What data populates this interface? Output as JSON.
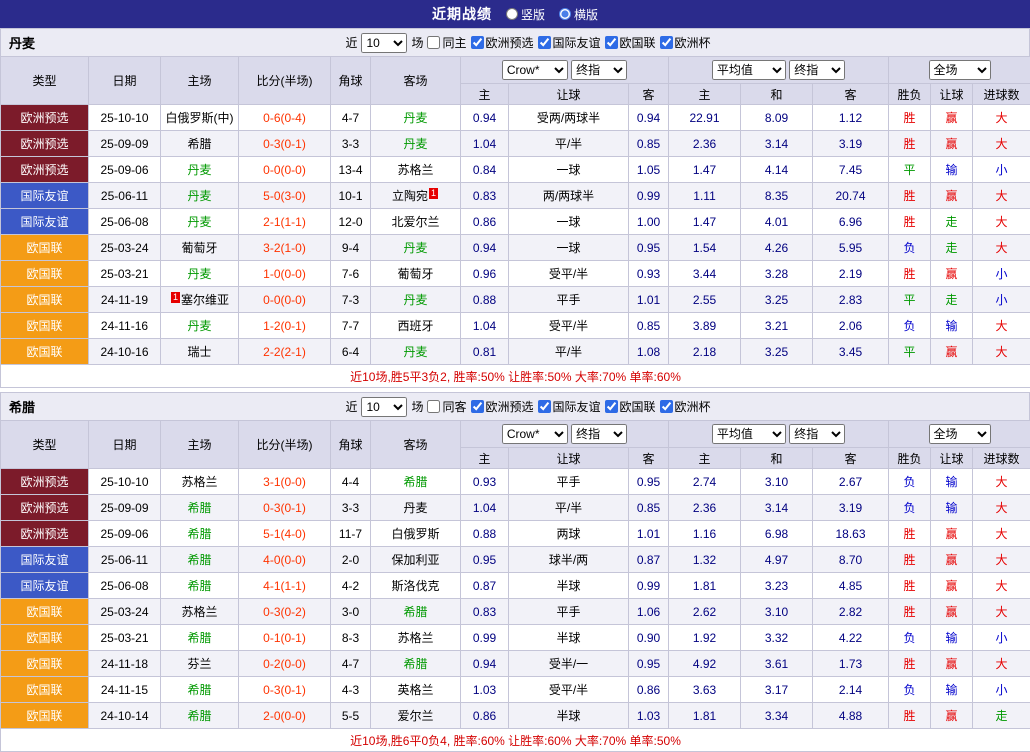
{
  "page": {
    "title": "近期战绩",
    "view_options": [
      {
        "label": "竖版",
        "selected": false
      },
      {
        "label": "横版",
        "selected": true
      }
    ]
  },
  "filter": {
    "near_label": "近",
    "count_value": "10",
    "games_label": "场",
    "competitions": [
      "欧洲预选",
      "国际友谊",
      "欧国联",
      "欧洲杯"
    ]
  },
  "table_header": {
    "cols": [
      "类型",
      "日期",
      "主场",
      "比分(半场)",
      "角球",
      "客场"
    ],
    "bookmaker": "Crow*",
    "final_label": "终指",
    "average_label": "平均值",
    "full_label": "全场",
    "asian_sub": [
      "主",
      "让球",
      "客"
    ],
    "euro_sub": [
      "主",
      "和",
      "客"
    ],
    "result_sub": [
      "胜负",
      "让球",
      "进球数"
    ]
  },
  "colors": {
    "topbar": "#2b2b8c",
    "euro_qualifier": "#7c1b2a",
    "friendly": "#3c59c6",
    "nations_league": "#f49c16",
    "win": "#e60000",
    "draw": "#009900",
    "loss": "#0000cc",
    "score": "#ff3300",
    "team_highlight": "#009900",
    "odds": "#000080",
    "summary": "#d40000"
  },
  "sections": [
    {
      "team": "丹麦",
      "same_label": "同主",
      "summary": "近10场,胜5平3负2, 胜率:50% 让胜率:50% 大率:70% 单率:60%",
      "rows": [
        {
          "type": "欧洲预选",
          "date": "25-10-10",
          "home": "白俄罗斯(中)",
          "away": "丹麦",
          "away_hl": true,
          "score": "0-6(0-4)",
          "corners": "4-7",
          "asian": [
            "0.94",
            "受两/两球半",
            "0.94"
          ],
          "euro": [
            "22.91",
            "8.09",
            "1.12"
          ],
          "results": [
            "胜",
            "赢",
            "大"
          ]
        },
        {
          "type": "欧洲预选",
          "date": "25-09-09",
          "home": "希腊",
          "away": "丹麦",
          "away_hl": true,
          "score": "0-3(0-1)",
          "corners": "3-3",
          "asian": [
            "1.04",
            "平/半",
            "0.85"
          ],
          "euro": [
            "2.36",
            "3.14",
            "3.19"
          ],
          "results": [
            "胜",
            "赢",
            "大"
          ]
        },
        {
          "type": "欧洲预选",
          "date": "25-09-06",
          "home": "丹麦",
          "home_hl": true,
          "away": "苏格兰",
          "score": "0-0(0-0)",
          "corners": "13-4",
          "asian": [
            "0.84",
            "一球",
            "1.05"
          ],
          "euro": [
            "1.47",
            "4.14",
            "7.45"
          ],
          "results": [
            "平",
            "输",
            "小"
          ]
        },
        {
          "type": "国际友谊",
          "date": "25-06-11",
          "home": "丹麦",
          "home_hl": true,
          "away": "立陶宛",
          "away_badge": "1",
          "score": "5-0(3-0)",
          "corners": "10-1",
          "asian": [
            "0.83",
            "两/两球半",
            "0.99"
          ],
          "euro": [
            "1.11",
            "8.35",
            "20.74"
          ],
          "results": [
            "胜",
            "赢",
            "大"
          ]
        },
        {
          "type": "国际友谊",
          "date": "25-06-08",
          "home": "丹麦",
          "home_hl": true,
          "away": "北爱尔兰",
          "score": "2-1(1-1)",
          "corners": "12-0",
          "asian": [
            "0.86",
            "一球",
            "1.00"
          ],
          "euro": [
            "1.47",
            "4.01",
            "6.96"
          ],
          "results": [
            "胜",
            "走",
            "大"
          ]
        },
        {
          "type": "欧国联",
          "date": "25-03-24",
          "home": "葡萄牙",
          "away": "丹麦",
          "away_hl": true,
          "score": "3-2(1-0)",
          "corners": "9-4",
          "asian": [
            "0.94",
            "一球",
            "0.95"
          ],
          "euro": [
            "1.54",
            "4.26",
            "5.95"
          ],
          "results": [
            "负",
            "走",
            "大"
          ]
        },
        {
          "type": "欧国联",
          "date": "25-03-21",
          "home": "丹麦",
          "home_hl": true,
          "away": "葡萄牙",
          "score": "1-0(0-0)",
          "corners": "7-6",
          "asian": [
            "0.96",
            "受平/半",
            "0.93"
          ],
          "euro": [
            "3.44",
            "3.28",
            "2.19"
          ],
          "results": [
            "胜",
            "赢",
            "小"
          ]
        },
        {
          "type": "欧国联",
          "date": "24-11-19",
          "home": "塞尔维亚",
          "home_badge": "1",
          "away": "丹麦",
          "away_hl": true,
          "score": "0-0(0-0)",
          "corners": "7-3",
          "asian": [
            "0.88",
            "平手",
            "1.01"
          ],
          "euro": [
            "2.55",
            "3.25",
            "2.83"
          ],
          "results": [
            "平",
            "走",
            "小"
          ]
        },
        {
          "type": "欧国联",
          "date": "24-11-16",
          "home": "丹麦",
          "home_hl": true,
          "away": "西班牙",
          "score": "1-2(0-1)",
          "corners": "7-7",
          "asian": [
            "1.04",
            "受平/半",
            "0.85"
          ],
          "euro": [
            "3.89",
            "3.21",
            "2.06"
          ],
          "results": [
            "负",
            "输",
            "大"
          ]
        },
        {
          "type": "欧国联",
          "date": "24-10-16",
          "home": "瑞士",
          "away": "丹麦",
          "away_hl": true,
          "score": "2-2(2-1)",
          "corners": "6-4",
          "asian": [
            "0.81",
            "平/半",
            "1.08"
          ],
          "euro": [
            "2.18",
            "3.25",
            "3.45"
          ],
          "results": [
            "平",
            "赢",
            "大"
          ]
        }
      ]
    },
    {
      "team": "希腊",
      "same_label": "同客",
      "summary": "近10场,胜6平0负4, 胜率:60% 让胜率:60% 大率:70% 单率:50%",
      "rows": [
        {
          "type": "欧洲预选",
          "date": "25-10-10",
          "home": "苏格兰",
          "away": "希腊",
          "away_hl": true,
          "score": "3-1(0-0)",
          "corners": "4-4",
          "asian": [
            "0.93",
            "平手",
            "0.95"
          ],
          "euro": [
            "2.74",
            "3.10",
            "2.67"
          ],
          "results": [
            "负",
            "输",
            "大"
          ]
        },
        {
          "type": "欧洲预选",
          "date": "25-09-09",
          "home": "希腊",
          "home_hl": true,
          "away": "丹麦",
          "score": "0-3(0-1)",
          "corners": "3-3",
          "asian": [
            "1.04",
            "平/半",
            "0.85"
          ],
          "euro": [
            "2.36",
            "3.14",
            "3.19"
          ],
          "results": [
            "负",
            "输",
            "大"
          ]
        },
        {
          "type": "欧洲预选",
          "date": "25-09-06",
          "home": "希腊",
          "home_hl": true,
          "away": "白俄罗斯",
          "score": "5-1(4-0)",
          "corners": "11-7",
          "asian": [
            "0.88",
            "两球",
            "1.01"
          ],
          "euro": [
            "1.16",
            "6.98",
            "18.63"
          ],
          "results": [
            "胜",
            "赢",
            "大"
          ]
        },
        {
          "type": "国际友谊",
          "date": "25-06-11",
          "home": "希腊",
          "home_hl": true,
          "away": "保加利亚",
          "score": "4-0(0-0)",
          "corners": "2-0",
          "asian": [
            "0.95",
            "球半/两",
            "0.87"
          ],
          "euro": [
            "1.32",
            "4.97",
            "8.70"
          ],
          "results": [
            "胜",
            "赢",
            "大"
          ]
        },
        {
          "type": "国际友谊",
          "date": "25-06-08",
          "home": "希腊",
          "home_hl": true,
          "away": "斯洛伐克",
          "score": "4-1(1-1)",
          "corners": "4-2",
          "asian": [
            "0.87",
            "半球",
            "0.99"
          ],
          "euro": [
            "1.81",
            "3.23",
            "4.85"
          ],
          "results": [
            "胜",
            "赢",
            "大"
          ]
        },
        {
          "type": "欧国联",
          "date": "25-03-24",
          "home": "苏格兰",
          "away": "希腊",
          "away_hl": true,
          "score": "0-3(0-2)",
          "corners": "3-0",
          "asian": [
            "0.83",
            "平手",
            "1.06"
          ],
          "euro": [
            "2.62",
            "3.10",
            "2.82"
          ],
          "results": [
            "胜",
            "赢",
            "大"
          ]
        },
        {
          "type": "欧国联",
          "date": "25-03-21",
          "home": "希腊",
          "home_hl": true,
          "away": "苏格兰",
          "score": "0-1(0-1)",
          "corners": "8-3",
          "asian": [
            "0.99",
            "半球",
            "0.90"
          ],
          "euro": [
            "1.92",
            "3.32",
            "4.22"
          ],
          "results": [
            "负",
            "输",
            "小"
          ]
        },
        {
          "type": "欧国联",
          "date": "24-11-18",
          "home": "芬兰",
          "away": "希腊",
          "away_hl": true,
          "score": "0-2(0-0)",
          "corners": "4-7",
          "asian": [
            "0.94",
            "受半/一",
            "0.95"
          ],
          "euro": [
            "4.92",
            "3.61",
            "1.73"
          ],
          "results": [
            "胜",
            "赢",
            "大"
          ]
        },
        {
          "type": "欧国联",
          "date": "24-11-15",
          "home": "希腊",
          "home_hl": true,
          "away": "英格兰",
          "score": "0-3(0-1)",
          "corners": "4-3",
          "asian": [
            "1.03",
            "受平/半",
            "0.86"
          ],
          "euro": [
            "3.63",
            "3.17",
            "2.14"
          ],
          "results": [
            "负",
            "输",
            "小"
          ]
        },
        {
          "type": "欧国联",
          "date": "24-10-14",
          "home": "希腊",
          "home_hl": true,
          "away": "爱尔兰",
          "score": "2-0(0-0)",
          "corners": "5-5",
          "asian": [
            "0.86",
            "半球",
            "1.03"
          ],
          "euro": [
            "1.81",
            "3.34",
            "4.88"
          ],
          "results": [
            "胜",
            "赢",
            "走"
          ]
        }
      ]
    }
  ]
}
